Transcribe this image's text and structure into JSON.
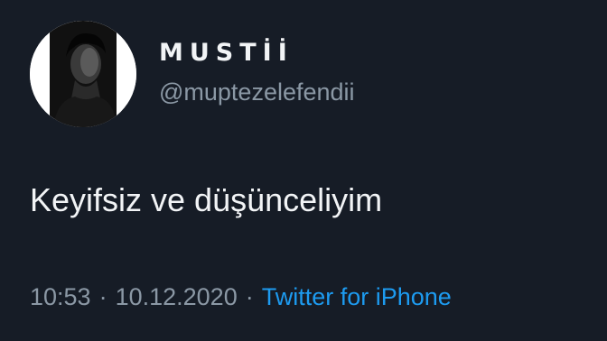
{
  "tweet": {
    "display_name": "MUSTİİ",
    "handle": "@muptezelefendii",
    "text": "Keyifsiz ve düşünceliyim",
    "time": "10:53",
    "separator": "·",
    "date": "10.12.2020",
    "source": "Twitter for iPhone"
  },
  "colors": {
    "background": "#161c26",
    "text": "#f2f4f6",
    "muted": "#8b98a5",
    "link": "#1d9bf0"
  },
  "icons": {
    "avatar": "profile-photo"
  }
}
